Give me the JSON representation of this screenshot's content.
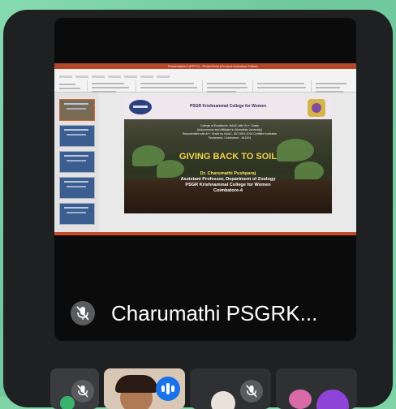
{
  "presentation": {
    "window_title": "Presentation1 (PPTX) - PowerPoint (Product Activation Failed)",
    "slide": {
      "college_name": "PSGR Krishnammal College for Women",
      "subtitle_lines": [
        "College of Excellence, NAAC with 'A++' Grade",
        "(Autonomous and Affiliated to Bharathiar University)",
        "Reaccredited with A++ Grade by NAAC, ISO 9001:2015 Certified Institution",
        "Peelamedu, Coimbatore - 641004"
      ],
      "title": "GIVING BACK TO SOIL",
      "presenter": "Dr. Charumathi Pushparaj",
      "designation": "Assistant Professor, Department of Zoology",
      "institution": "PSGR Krishnammal College for Women",
      "city": "Coimbatore-4"
    }
  },
  "participant": {
    "name": "Charumathi PSGRK...",
    "mic_icon": "mic-off-icon"
  },
  "icons": {
    "mic_off": "mic-off-icon",
    "speaking": "speaking-indicator-icon"
  },
  "colors": {
    "ppt_accent": "#b7472a",
    "slide_title": "#f3d54a",
    "speaking_blue": "#1a73e8",
    "avatar_purple": "#8e44d6"
  }
}
